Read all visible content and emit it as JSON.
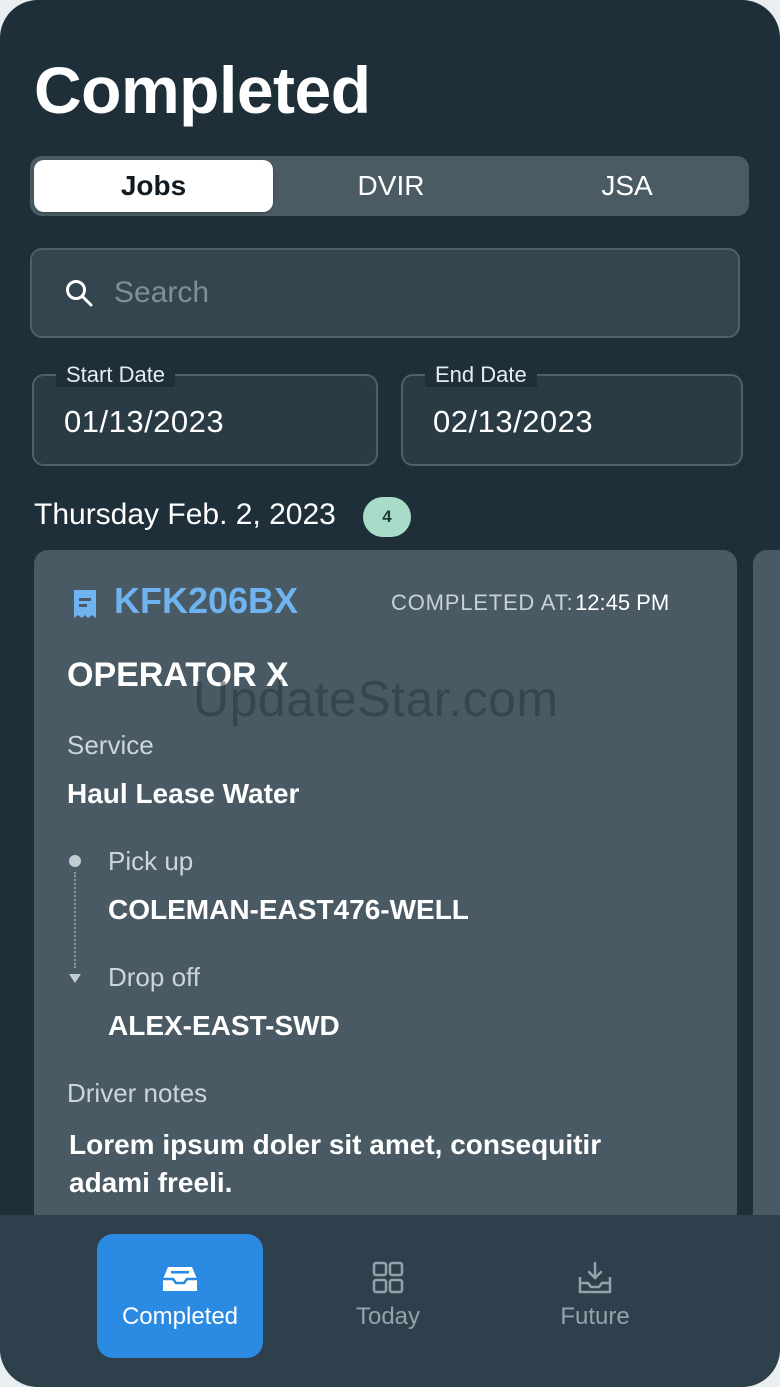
{
  "header": {
    "title": "Completed"
  },
  "tabs": [
    {
      "label": "Jobs",
      "active": true
    },
    {
      "label": "DVIR",
      "active": false
    },
    {
      "label": "JSA",
      "active": false
    }
  ],
  "search": {
    "placeholder": "Search",
    "value": ""
  },
  "filters": {
    "start_date": {
      "label": "Start Date",
      "value": "01/13/2023"
    },
    "end_date": {
      "label": "End Date",
      "value": "02/13/2023"
    }
  },
  "group": {
    "date": "Thursday Feb. 2, 2023",
    "count": "4"
  },
  "job_card": {
    "job_id": "KFK206BX",
    "completed_at_label": "COMPLETED AT:",
    "completed_at_time": "12:45 PM",
    "operator": "OPERATOR X",
    "service_label": "Service",
    "service_value": "Haul Lease Water",
    "pickup_label": "Pick up",
    "pickup_value": "COLEMAN-EAST476-WELL",
    "dropoff_label": "Drop off",
    "dropoff_value": "ALEX-EAST-SWD",
    "notes_label": "Driver notes",
    "notes_value": "Lorem ipsum doler sit amet, consequitir adami freeli."
  },
  "watermark": "UpdateStar.com",
  "bottom_nav": [
    {
      "label": "Completed",
      "icon": "inbox-icon",
      "active": true
    },
    {
      "label": "Today",
      "icon": "grid-icon",
      "active": false
    },
    {
      "label": "Future",
      "icon": "tray-download-icon",
      "active": false
    }
  ],
  "colors": {
    "background": "#1f2f3a",
    "card": "#4a5a64",
    "accent_blue": "#2b8ae2",
    "job_id_blue": "#6fb4f0",
    "badge_green": "#a8dcc9"
  }
}
